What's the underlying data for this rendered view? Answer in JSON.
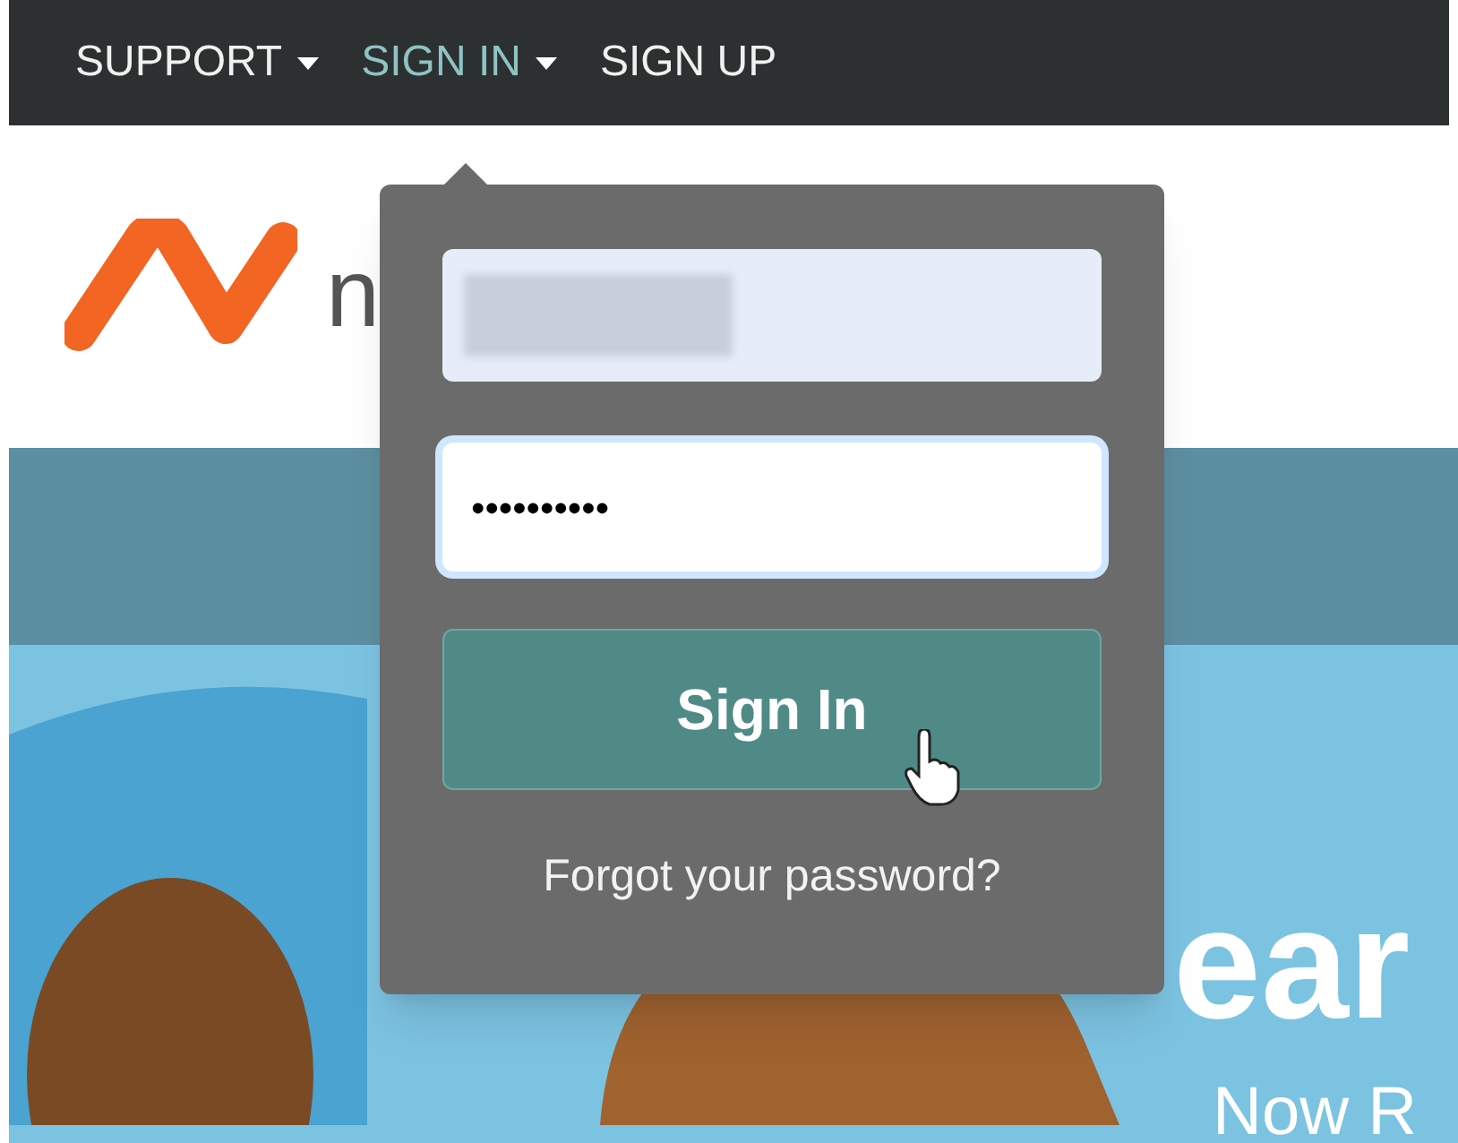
{
  "nav": {
    "items": [
      {
        "label": "SUPPORT",
        "has_caret": true,
        "selected": false
      },
      {
        "label": "SIGN IN",
        "has_caret": true,
        "selected": true
      },
      {
        "label": "SIGN UP",
        "has_caret": false,
        "selected": false
      }
    ]
  },
  "logo": {
    "text": "n"
  },
  "hero": {
    "headline": "ear",
    "subline": "Now R"
  },
  "signin_popup": {
    "username": {
      "focused": false
    },
    "password": {
      "value": "••••••••••",
      "focused": true
    },
    "button": "Sign In",
    "forgot_link": "Forgot your password?"
  }
}
